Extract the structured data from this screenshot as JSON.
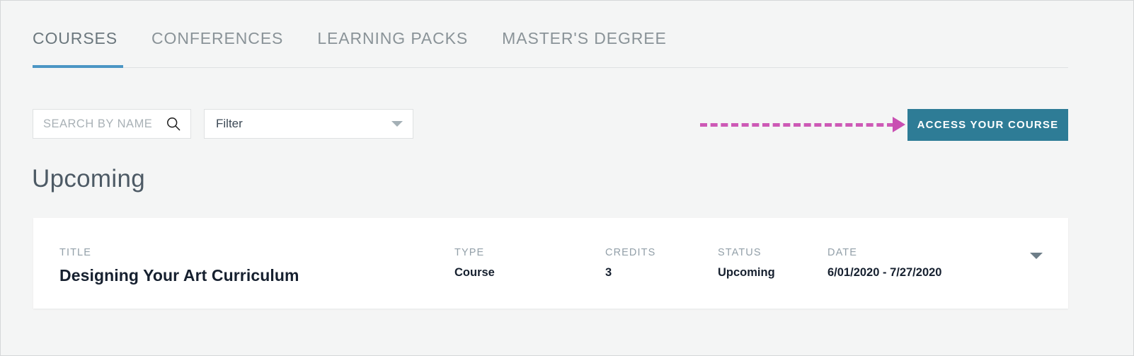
{
  "tabs": [
    {
      "label": "COURSES",
      "active": true
    },
    {
      "label": "CONFERENCES",
      "active": false
    },
    {
      "label": "LEARNING PACKS",
      "active": false
    },
    {
      "label": "MASTER'S DEGREE",
      "active": false
    }
  ],
  "controls": {
    "search": {
      "placeholder": "SEARCH BY NAME",
      "value": "",
      "icon": "search-icon"
    },
    "filter": {
      "label": "Filter",
      "icon": "chevron-down-icon"
    },
    "cta": {
      "label": "ACCESS YOUR COURSE",
      "color": "#2e7c96"
    },
    "annotation_arrow": {
      "color": "#c94fb2",
      "style": "dashed",
      "direction": "right",
      "points_to": "ACCESS YOUR COURSE"
    }
  },
  "section": {
    "heading": "Upcoming"
  },
  "card": {
    "columns": [
      {
        "label": "TITLE",
        "value": "Designing Your Art Curriculum"
      },
      {
        "label": "TYPE",
        "value": "Course"
      },
      {
        "label": "CREDITS",
        "value": "3"
      },
      {
        "label": "STATUS",
        "value": "Upcoming"
      },
      {
        "label": "DATE",
        "value": "6/01/2020 - 7/27/2020"
      }
    ],
    "expand_icon": "chevron-down-icon"
  },
  "colors": {
    "page_background": "#f4f5f5",
    "active_tab_underline": "#4b96c4",
    "cta": "#2e7c96",
    "arrow": "#c94fb2"
  }
}
